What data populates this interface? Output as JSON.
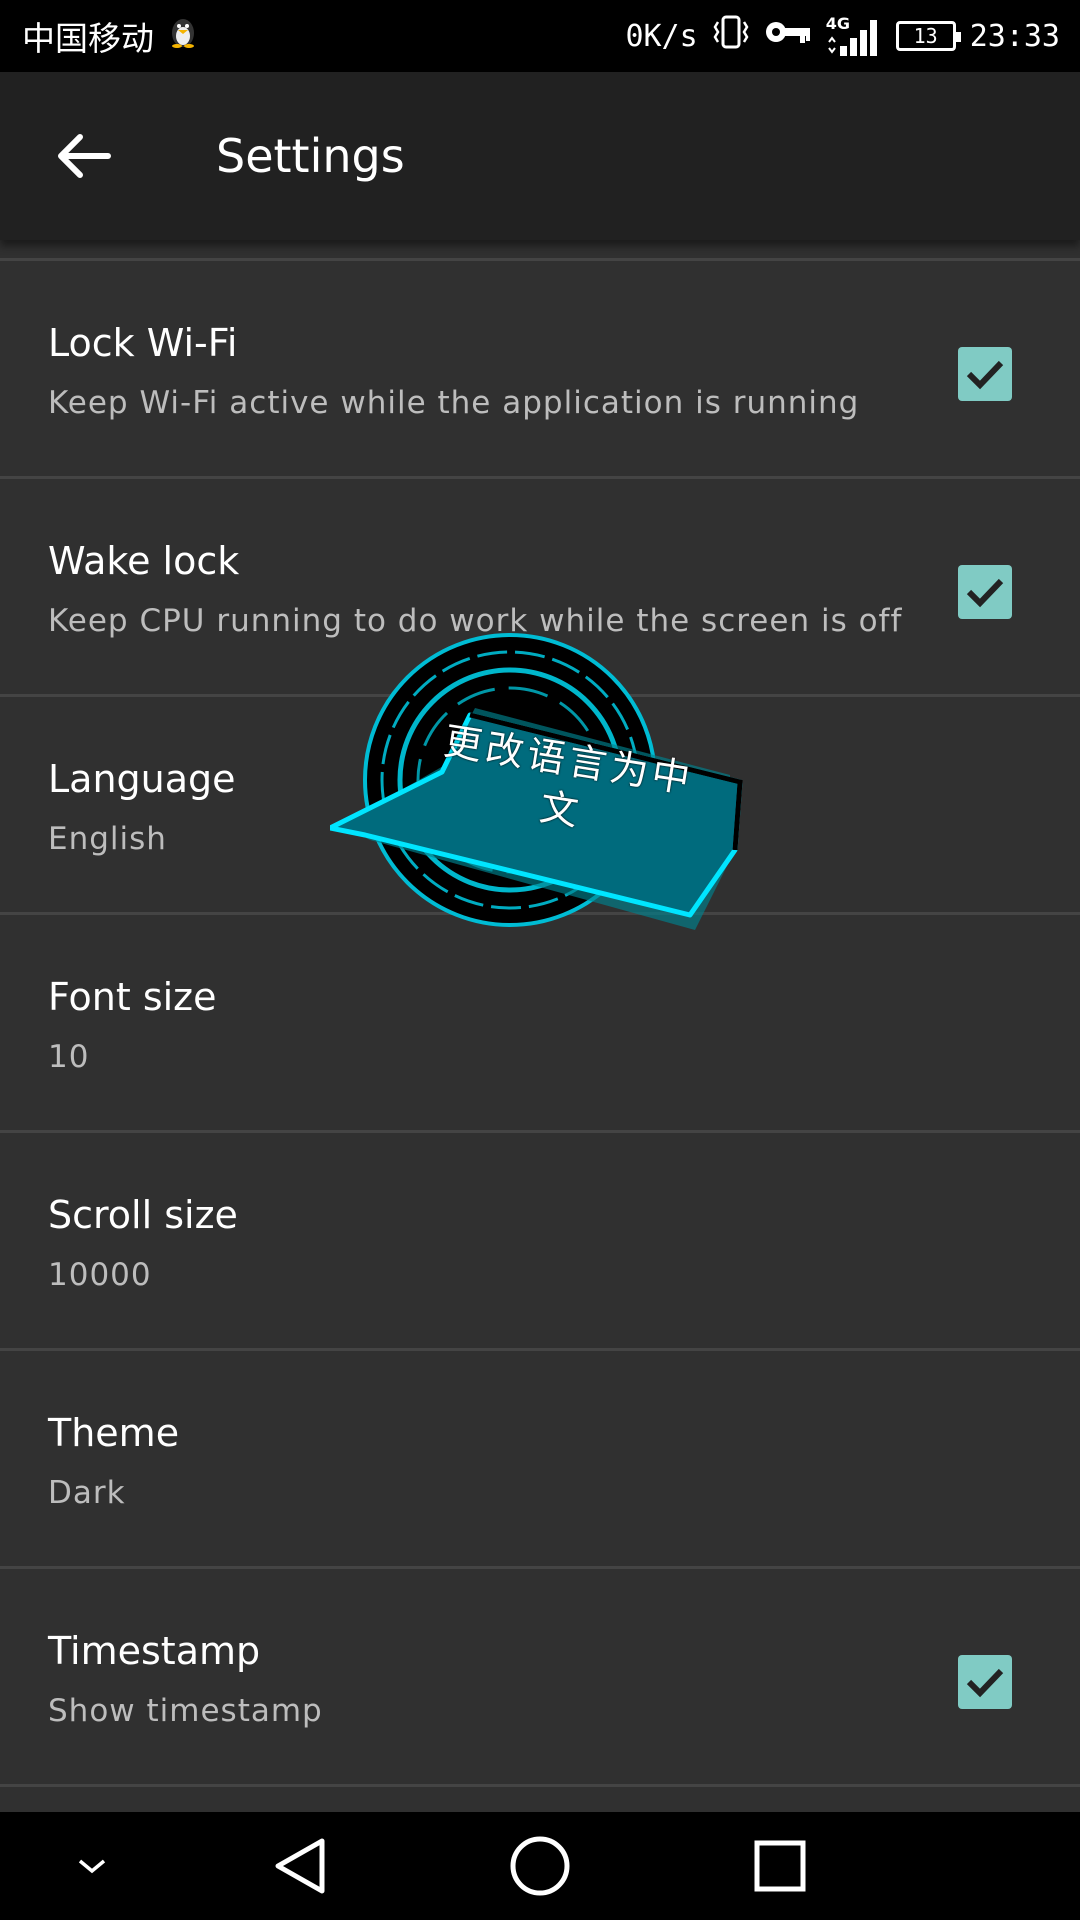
{
  "status_bar": {
    "carrier": "中国移动",
    "speed": "0K/s",
    "network": "4G",
    "battery": "13",
    "time": "23:33"
  },
  "app_bar": {
    "title": "Settings"
  },
  "settings": [
    {
      "title": "Lock Wi-Fi",
      "summary": "Keep Wi-Fi active while the application is running",
      "checked": true
    },
    {
      "title": "Wake lock",
      "summary": "Keep CPU running to do work while the screen is off",
      "checked": true
    },
    {
      "title": "Language",
      "summary": "English",
      "checked": null
    },
    {
      "title": "Font size",
      "summary": "10",
      "checked": null
    },
    {
      "title": "Scroll size",
      "summary": "10000",
      "checked": null
    },
    {
      "title": "Theme",
      "summary": "Dark",
      "checked": null
    },
    {
      "title": "Timestamp",
      "summary": "Show timestamp",
      "checked": true
    }
  ],
  "overlay": {
    "label": "更改语言为中文"
  },
  "colors": {
    "accent": "#80cbc4",
    "background": "#303030",
    "app_bar": "#212121",
    "overlay": "#006b7d"
  }
}
